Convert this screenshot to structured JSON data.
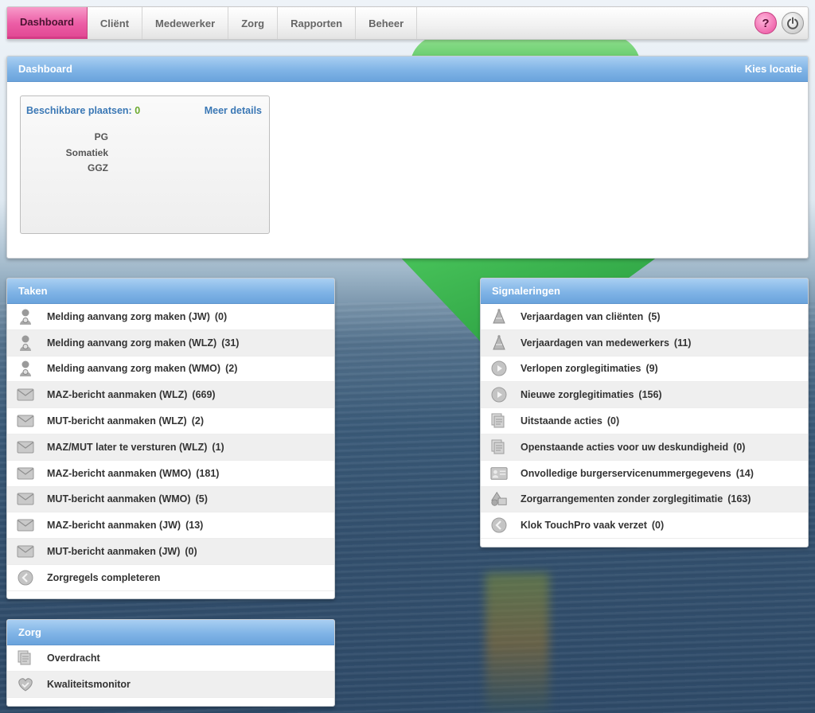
{
  "nav": {
    "items": [
      {
        "label": "Dashboard",
        "active": true
      },
      {
        "label": "Cliënt"
      },
      {
        "label": "Medewerker"
      },
      {
        "label": "Zorg"
      },
      {
        "label": "Rapporten"
      },
      {
        "label": "Beheer"
      }
    ],
    "help_label": "?",
    "power_label": "⏻"
  },
  "dashboard": {
    "title": "Dashboard",
    "location_link": "Kies locatie",
    "availability": {
      "label": "Beschikbare plaatsen:",
      "count": "0",
      "more_link": "Meer details",
      "categories": [
        "PG",
        "Somatiek",
        "GGZ"
      ]
    }
  },
  "taken": {
    "title": "Taken",
    "items": [
      {
        "label": "Melding aanvang zorg maken (JW)",
        "count": "(0)",
        "icon": "person-icon"
      },
      {
        "label": "Melding aanvang zorg maken (WLZ)",
        "count": "(31)",
        "icon": "person-icon"
      },
      {
        "label": "Melding aanvang zorg maken (WMO)",
        "count": "(2)",
        "icon": "person-icon"
      },
      {
        "label": "MAZ-bericht aanmaken (WLZ)",
        "count": "(669)",
        "icon": "envelope-icon"
      },
      {
        "label": "MUT-bericht aanmaken (WLZ)",
        "count": "(2)",
        "icon": "envelope-icon"
      },
      {
        "label": "MAZ/MUT later te versturen (WLZ)",
        "count": "(1)",
        "icon": "envelope-icon"
      },
      {
        "label": "MAZ-bericht aanmaken (WMO)",
        "count": "(181)",
        "icon": "envelope-icon"
      },
      {
        "label": "MUT-bericht aanmaken (WMO)",
        "count": "(5)",
        "icon": "envelope-icon"
      },
      {
        "label": "MAZ-bericht aanmaken (JW)",
        "count": "(13)",
        "icon": "envelope-icon"
      },
      {
        "label": "MUT-bericht aanmaken (JW)",
        "count": "(0)",
        "icon": "envelope-icon"
      },
      {
        "label": "Zorgregels completeren",
        "count": "",
        "icon": "arrow-left-circle-icon"
      }
    ]
  },
  "signaleringen": {
    "title": "Signaleringen",
    "items": [
      {
        "label": "Verjaardagen van cliënten",
        "count": "(5)",
        "icon": "party-hat-icon"
      },
      {
        "label": "Verjaardagen van medewerkers",
        "count": "(11)",
        "icon": "party-hat-icon"
      },
      {
        "label": "Verlopen zorglegitimaties",
        "count": "(9)",
        "icon": "play-circle-icon"
      },
      {
        "label": "Nieuwe zorglegitimaties",
        "count": "(156)",
        "icon": "play-circle-icon"
      },
      {
        "label": "Uitstaande acties",
        "count": "(0)",
        "icon": "documents-icon"
      },
      {
        "label": "Openstaande acties voor uw deskundigheid",
        "count": "(0)",
        "icon": "documents-icon"
      },
      {
        "label": "Onvolledige burgerservicenummergegevens",
        "count": "(14)",
        "icon": "id-card-icon"
      },
      {
        "label": "Zorgarrangementen zonder zorglegitimatie",
        "count": "(163)",
        "icon": "shapes-icon"
      },
      {
        "label": "Klok TouchPro vaak verzet",
        "count": "(0)",
        "icon": "arrow-left-circle-icon"
      }
    ]
  },
  "zorg": {
    "title": "Zorg",
    "items": [
      {
        "label": "Overdracht",
        "icon": "documents-icon"
      },
      {
        "label": "Kwaliteitsmonitor",
        "icon": "heart-hand-icon"
      }
    ]
  }
}
